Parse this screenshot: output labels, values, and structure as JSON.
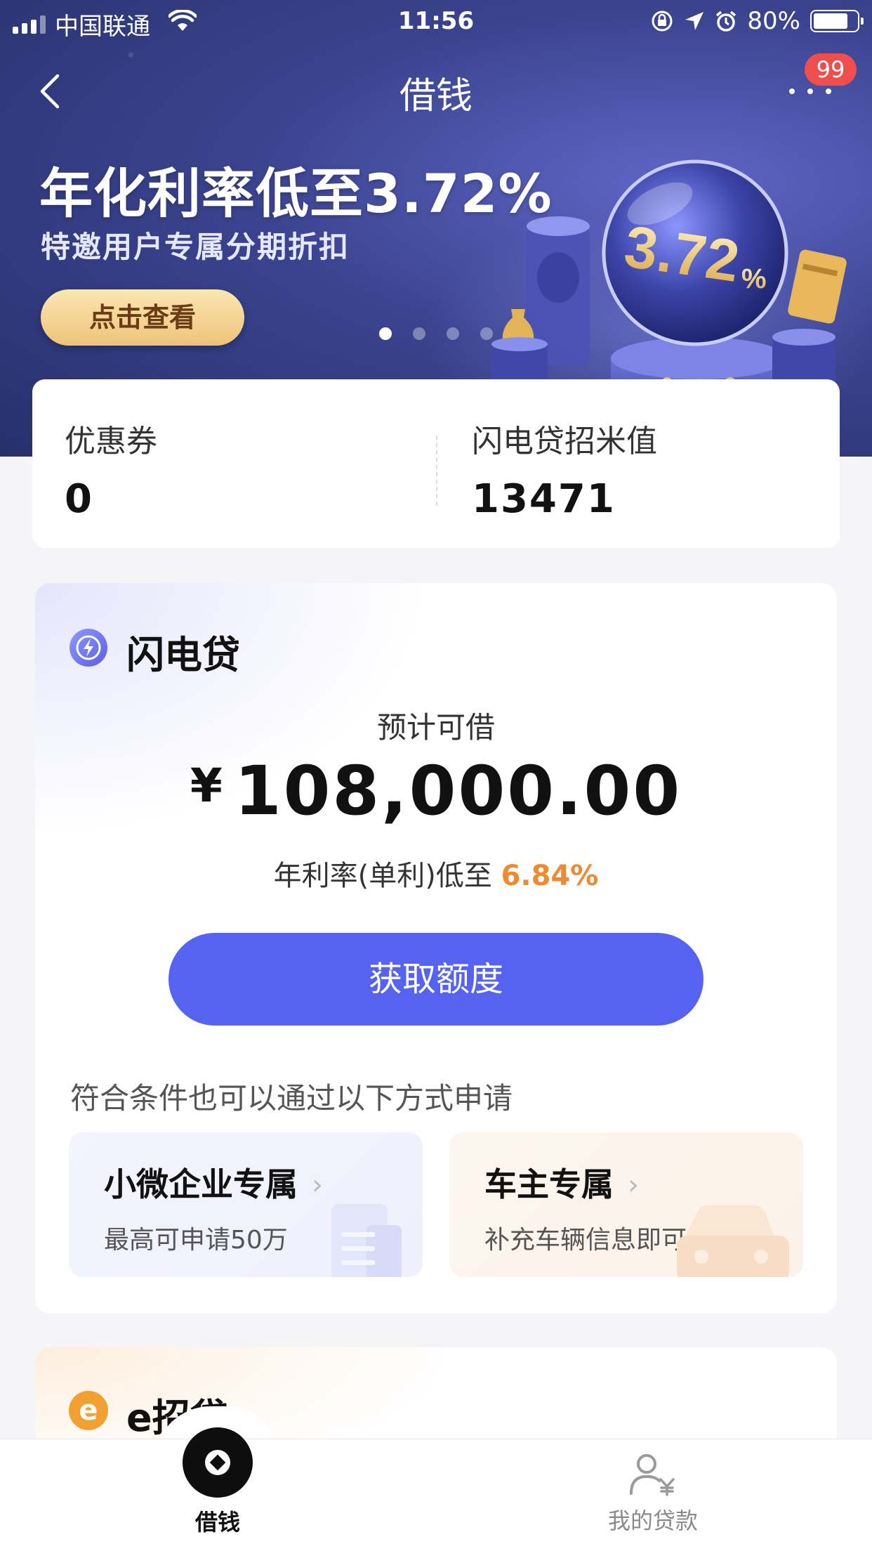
{
  "status_bar": {
    "carrier": "中国联通",
    "time": "11:56",
    "battery": "80%"
  },
  "nav": {
    "title": "借钱",
    "badge": "99"
  },
  "banner": {
    "headline": "年化利率低至3.72%",
    "subtitle": "特邀用户专属分期折扣",
    "button": "点击查看",
    "orb_text": "3.72",
    "orb_percent": "%",
    "active_slide": 1,
    "slide_count": 4
  },
  "stats": {
    "coupon_label": "优惠券",
    "coupon_value": "0",
    "score_label": "闪电贷招米值",
    "score_value": "13471"
  },
  "product": {
    "name": "闪电贷",
    "estimate_label": "预计可借",
    "currency": "¥",
    "amount": "108,000.00",
    "rate_prefix": "年利率(单利)低至",
    "rate_value": "6.84%",
    "cta": "获取额度",
    "alt_title": "符合条件也可以通过以下方式申请",
    "options": [
      {
        "title": "小微企业专属",
        "subtitle": "最高可申请50万"
      },
      {
        "title": "车主专属",
        "subtitle": "补充车辆信息即可申请"
      }
    ]
  },
  "product2": {
    "icon_letter": "e",
    "name": "e招贷"
  },
  "tabbar": {
    "tabs": [
      {
        "label": "借钱"
      },
      {
        "label": "我的贷款"
      }
    ]
  },
  "colors": {
    "primary": "#5563f0",
    "rate_orange": "#f08a30",
    "badge_red": "#f04d4d",
    "banner_button": "#eec37a"
  }
}
